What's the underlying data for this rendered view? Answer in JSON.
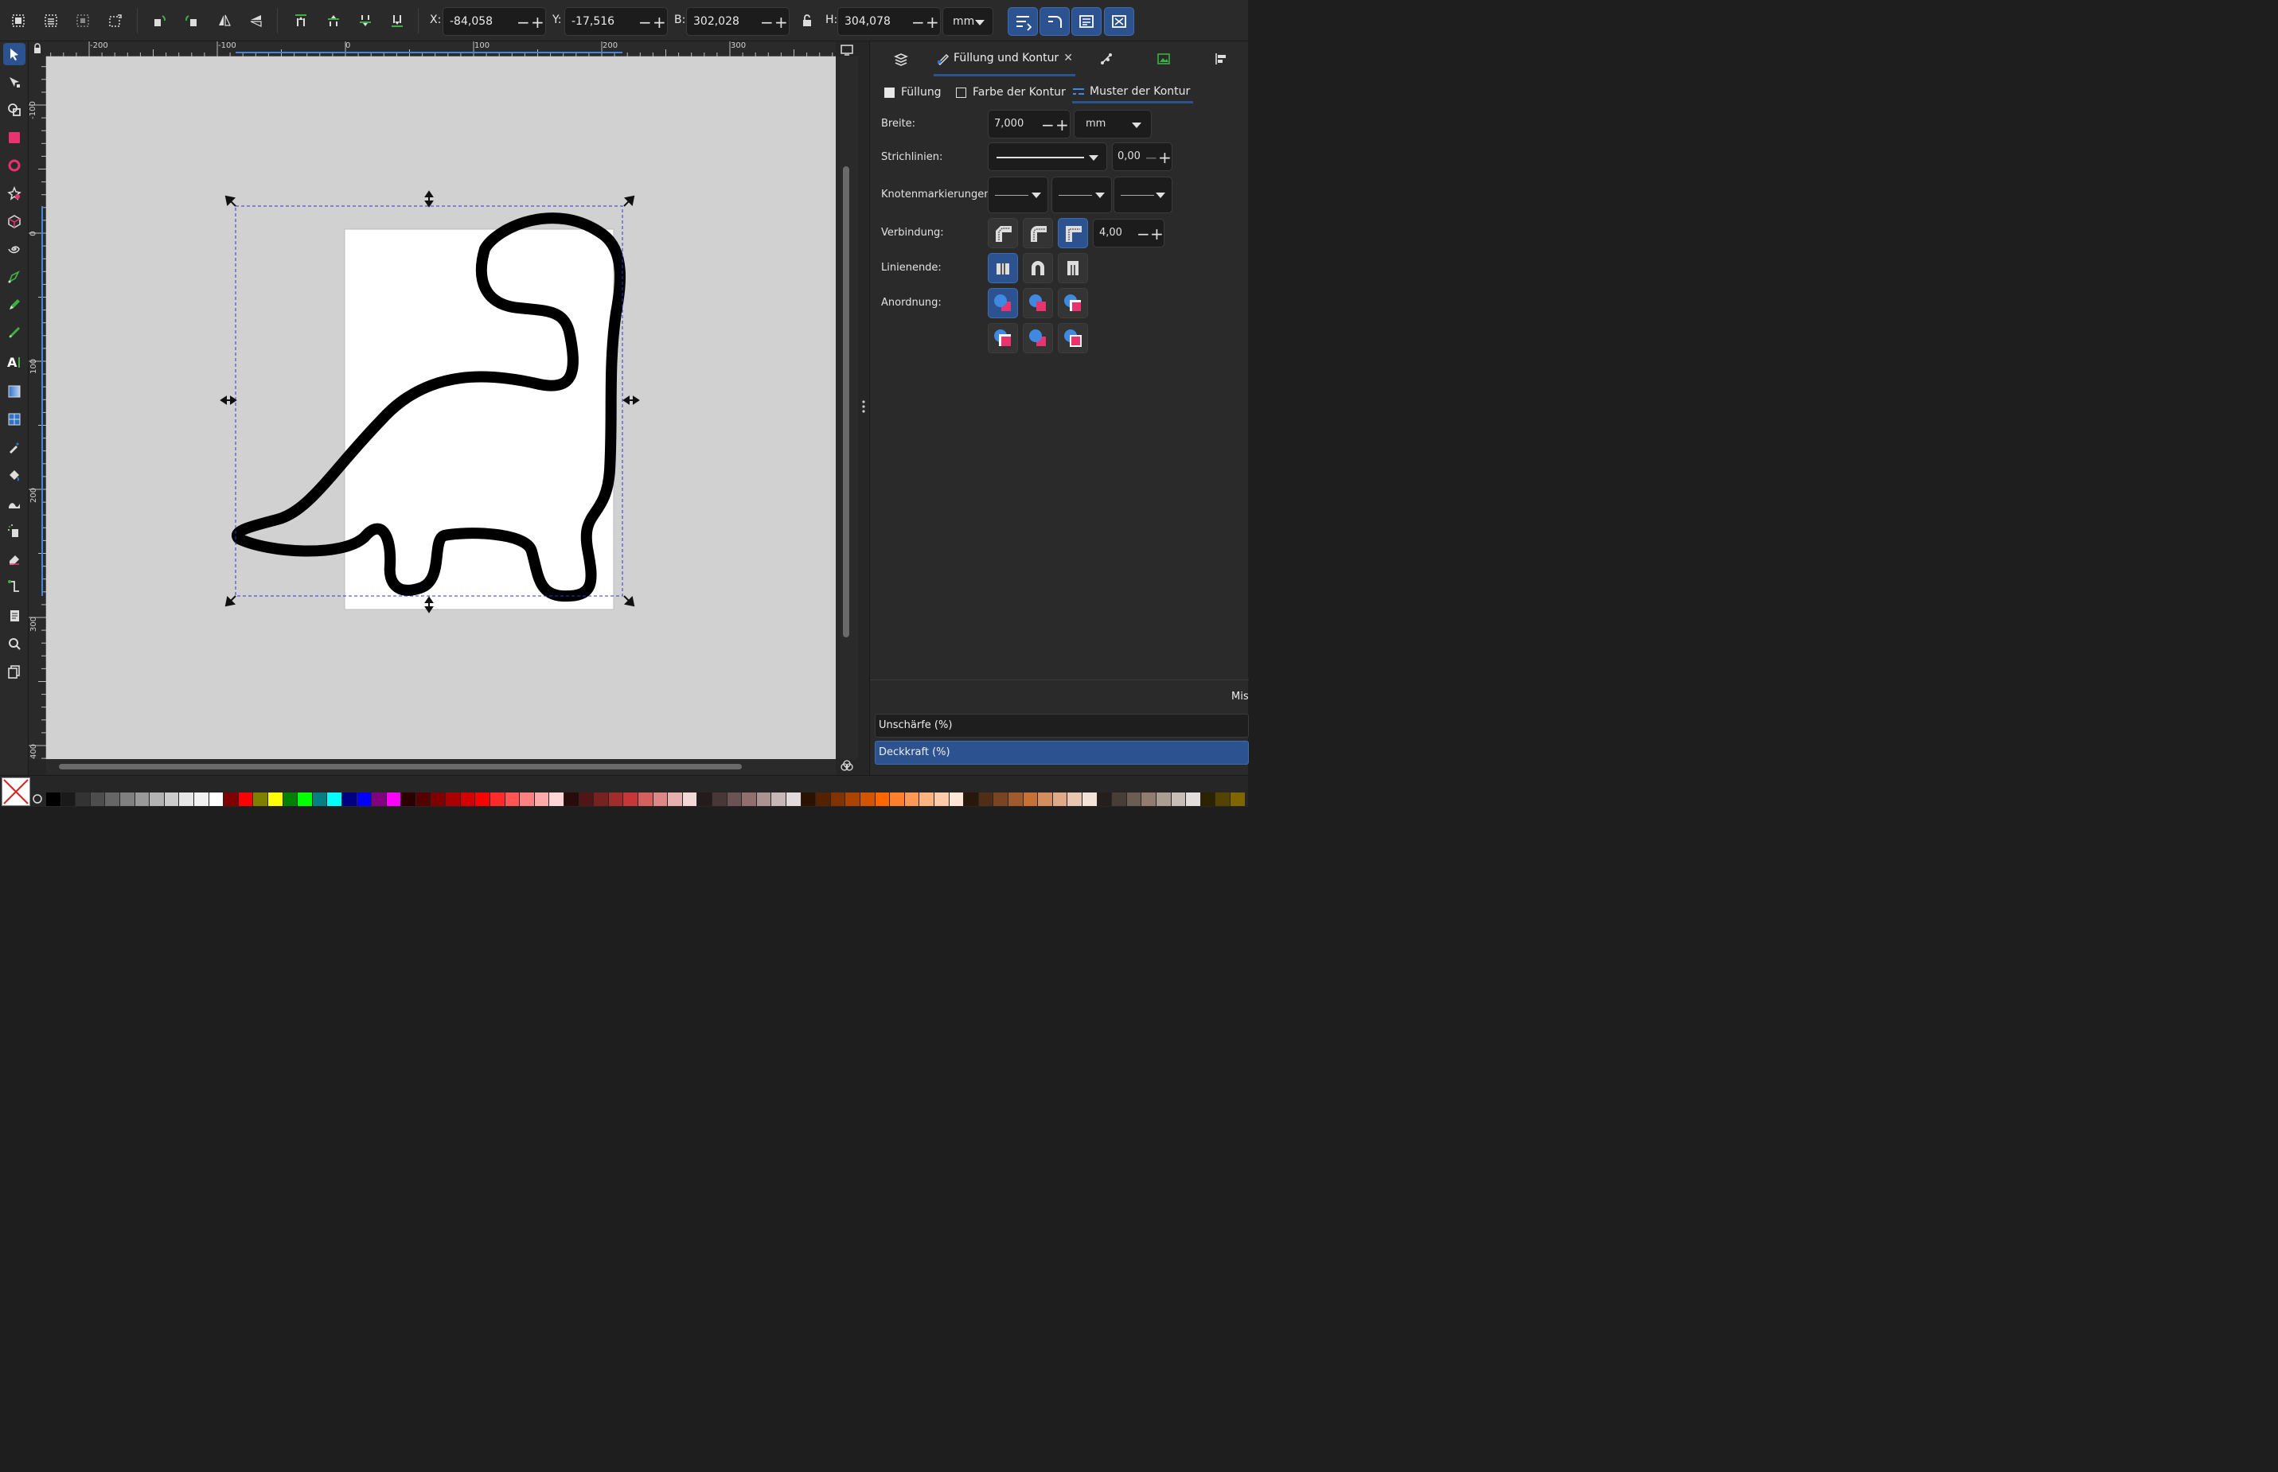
{
  "toolbar": {
    "x_label": "X:",
    "x_value": "-84,058",
    "y_label": "Y:",
    "y_value": "-17,516",
    "w_label": "B:",
    "w_value": "302,028",
    "h_label": "H:",
    "h_value": "304,078",
    "unit": "mm"
  },
  "rulers": {
    "horizontal": [
      "-200",
      "-100",
      "0",
      "100",
      "200",
      "300"
    ],
    "vertical": [
      "-100",
      "0",
      "100",
      "200",
      "300",
      "400"
    ]
  },
  "panel": {
    "tab_label": "Füllung und Kontur",
    "subtabs": {
      "fill": "Füllung",
      "stroke_paint": "Farbe der Kontur",
      "stroke_style": "Muster der Kontur"
    },
    "width_label": "Breite:",
    "width_value": "7,000",
    "width_unit": "mm",
    "dashes_label": "Strichlinien:",
    "dash_offset": "0,00",
    "markers_label": "Knotenmarkierungen:",
    "join_label": "Verbindung:",
    "miter_value": "4,00",
    "cap_label": "Linienende:",
    "order_label": "Anordnung:",
    "blend_label": "Mis",
    "blur_label": "Unschärfe (%)",
    "opacity_label": "Deckkraft (%)"
  },
  "colors": {
    "accent": "#2d5290",
    "stroke": "#000000",
    "canvas_bg": "#d1d1d1",
    "selection": "#3333cc"
  },
  "palette": [
    "#000000",
    "#1a1a1a",
    "#333333",
    "#4d4d4d",
    "#666666",
    "#808080",
    "#999999",
    "#b3b3b3",
    "#cccccc",
    "#e6e6e6",
    "#f2f2f2",
    "#ffffff",
    "#800000",
    "#ff0000",
    "#808000",
    "#ffff00",
    "#008000",
    "#00ff00",
    "#008080",
    "#00ffff",
    "#000080",
    "#0000ff",
    "#800080",
    "#ff00ff",
    "#2b0000",
    "#550000",
    "#800000",
    "#aa0000",
    "#d40000",
    "#ff0000",
    "#ff2a2a",
    "#ff5555",
    "#ff8080",
    "#ffaaaa",
    "#ffd5d5",
    "#280b0b",
    "#501616",
    "#782121",
    "#a02c2c",
    "#c83737",
    "#d35f5f",
    "#de8787",
    "#e9afaf",
    "#f4d7d7",
    "#241c1c",
    "#483737",
    "#6c5353",
    "#916f6f",
    "#ac9393",
    "#c8b7b7",
    "#e3dbdb",
    "#2b1100",
    "#552200",
    "#803300",
    "#aa4400",
    "#d45500",
    "#ff6600",
    "#ff7f2a",
    "#ff9955",
    "#ffb380",
    "#ffccaa",
    "#ffe6d5",
    "#28170b",
    "#502d16",
    "#784421",
    "#a05a2c",
    "#c87137",
    "#d38d5f",
    "#deaa87",
    "#e9c6af",
    "#f4e3d7",
    "#241f1c",
    "#483e37",
    "#6c5d53",
    "#917c6f",
    "#ac9d93",
    "#c8beb7",
    "#e3dedb",
    "#2b2200",
    "#554400",
    "#806600"
  ]
}
